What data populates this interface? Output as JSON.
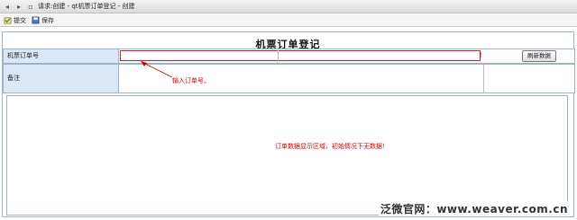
{
  "window": {
    "title": "请求:创建 - qt机票订单登记 - 创建"
  },
  "toolbar": {
    "submit_label": "提交",
    "save_label": "保存"
  },
  "form": {
    "title": "机票订单登记",
    "order_no_label": "机票订单号",
    "order_no_value": "",
    "remark_label": "备注",
    "refresh_button": "刷新数据",
    "required_mark": "!"
  },
  "annotations": {
    "input_hint": "输入订单号。",
    "data_hint": "订单数据显示区域，初始情况下无数据！"
  },
  "watermark": "泛微官网：www.weaver.com.cn",
  "colors": {
    "label_bg": "#d9e7f7",
    "border": "#9db3cc",
    "annotation_red": "#d40000"
  }
}
